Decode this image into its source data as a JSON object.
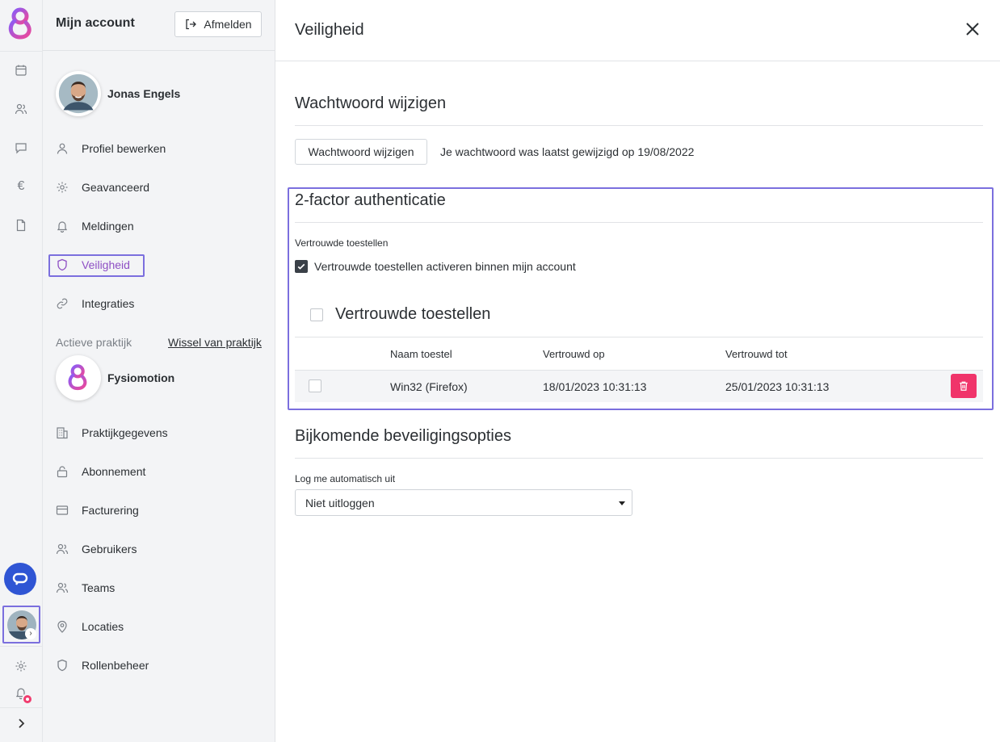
{
  "rail": {
    "icons": [
      "calendar-icon",
      "users-icon",
      "chat-icon",
      "euro-icon",
      "document-icon",
      "settings-icon",
      "bell-icon"
    ],
    "euro_glyph": "€",
    "expand_glyph": "›"
  },
  "account": {
    "title": "Mijn account",
    "logout_label": "Afmelden",
    "user_name": "Jonas Engels",
    "nav": [
      {
        "label": "Profiel bewerken",
        "icon": "user-icon"
      },
      {
        "label": "Geavanceerd",
        "icon": "gear-icon"
      },
      {
        "label": "Meldingen",
        "icon": "bell-icon"
      },
      {
        "label": "Veiligheid",
        "icon": "shield-icon"
      },
      {
        "label": "Integraties",
        "icon": "link-icon"
      }
    ],
    "active_practice_label": "Actieve praktijk",
    "switch_practice_link": "Wissel van praktijk",
    "practice_name": "Fysiomotion",
    "practice_nav": [
      {
        "label": "Praktijkgegevens",
        "icon": "building-icon"
      },
      {
        "label": "Abonnement",
        "icon": "lock-icon"
      },
      {
        "label": "Facturering",
        "icon": "credit-card-icon"
      },
      {
        "label": "Gebruikers",
        "icon": "users-icon"
      },
      {
        "label": "Teams",
        "icon": "team-icon"
      },
      {
        "label": "Locaties",
        "icon": "location-pin-icon"
      },
      {
        "label": "Rollenbeheer",
        "icon": "shield-icon"
      }
    ]
  },
  "main": {
    "title": "Veiligheid",
    "password": {
      "section_title": "Wachtwoord wijzigen",
      "button_label": "Wachtwoord wijzigen",
      "info": "Je wachtwoord was laatst gewijzigd op 19/08/2022"
    },
    "twofa": {
      "section_title": "2-factor authenticatie",
      "trusted_label": "Vertrouwde toestellen",
      "activate_checkbox_label": "Vertrouwde toestellen activeren binnen mijn account",
      "activate_checked": true,
      "devices_title": "Vertrouwde toestellen",
      "table": {
        "columns": [
          "Naam toestel",
          "Vertrouwd op",
          "Vertrouwd tot"
        ],
        "rows": [
          {
            "name": "Win32 (Firefox)",
            "trusted_on": "18/01/2023 10:31:13",
            "trusted_until": "25/01/2023 10:31:13"
          }
        ]
      }
    },
    "extra": {
      "section_title": "Bijkomende beveiligingsopties",
      "logout_label": "Log me automatisch uit",
      "logout_value": "Niet uitloggen"
    }
  },
  "colors": {
    "accent": "#8e4fc4",
    "highlight_border": "#7b6fde",
    "delete": "#f0346a",
    "chat": "#2f55d4"
  }
}
